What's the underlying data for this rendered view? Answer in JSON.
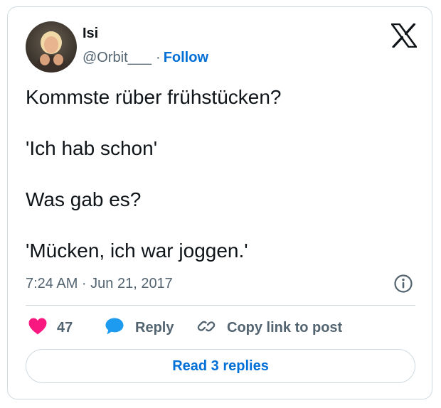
{
  "author": {
    "display_name": "Isi",
    "handle": "@Orbit___",
    "separator": "·",
    "follow_label": "Follow"
  },
  "logo": {
    "icon": "x-logo-icon"
  },
  "tweet": {
    "lines": [
      "Kommste rüber frühstücken?",
      "'Ich hab schon'",
      "Was gab es?",
      "'Mücken, ich war joggen.'"
    ],
    "timestamp": "7:24 AM · Jun 21, 2017"
  },
  "actions": {
    "like_count": "47",
    "reply_label": "Reply",
    "copy_label": "Copy link to post"
  },
  "read_replies_label": "Read 3 replies",
  "colors": {
    "text": "#0f1419",
    "secondary": "#536471",
    "link": "#006fd6",
    "heart": "#f91880",
    "reply_bubble": "#1d9bf0",
    "border": "#cfd9de"
  }
}
